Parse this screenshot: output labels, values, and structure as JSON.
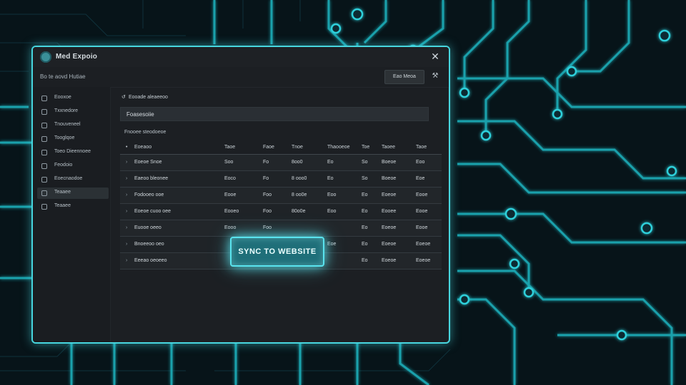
{
  "window": {
    "title": "Med Expoio"
  },
  "subbar": {
    "breadcrumb": "Bo te aovd Hutiae",
    "button_label": "Eao Meoa"
  },
  "sidebar": {
    "items": [
      {
        "label": "Eooxoe",
        "active": false
      },
      {
        "label": "Txxnedore",
        "active": false
      },
      {
        "label": "Tnouveneel",
        "active": false
      },
      {
        "label": "Tooglqoe",
        "active": false
      },
      {
        "label": "Toeo Dieennoee",
        "active": false
      },
      {
        "label": "Feodoio",
        "active": false
      },
      {
        "label": "Eoecnaodoe",
        "active": false
      },
      {
        "label": "Teaaee",
        "active": true
      },
      {
        "label": "Teaaee",
        "active": false
      }
    ]
  },
  "main": {
    "header": "Eooade aleaeeoo",
    "filter_label": "Foasesoiie",
    "section_label": "Fnooee steodoeoe",
    "table": {
      "headers": [
        "Eoeaoo",
        "Taoe",
        "Faoe",
        "Tnoe",
        "Thaooeoe",
        "Toe",
        "Taoee",
        "Taoe"
      ],
      "rows": [
        [
          "Eoeoe Snoe",
          "Soo",
          "Fo",
          "8oo0",
          "Eo",
          "So",
          "Boeoe",
          "Eoo"
        ],
        [
          "Eaeoo bleonee",
          "Eoco",
          "Fo",
          "8 ooo0",
          "Eo",
          "So",
          "Boeoe",
          "Eoe"
        ],
        [
          "Fodooeo ooe",
          "Eooe",
          "Foo",
          "8 oo0e",
          "Eoo",
          "Eo",
          "Eoeoe",
          "Eooe"
        ],
        [
          "Eoeoe cuoo oee",
          "Eooeo",
          "Foo",
          "80o0e",
          "Eoo",
          "Eo",
          "Eooee",
          "Eooe"
        ],
        [
          "Euooe oeeo",
          "Eooo",
          "Foo",
          "",
          "",
          "Eo",
          "Eoeoe",
          "Eooe"
        ],
        [
          "Bnoeeoo oeo",
          "",
          "",
          "",
          "Eoe",
          "Eo",
          "Eoeoe",
          "Eoeoe"
        ],
        [
          "Eeeao oeoeeo",
          "",
          "",
          "",
          "",
          "Eo",
          "Eoeoe",
          "Eoeoe"
        ]
      ]
    }
  },
  "sync_button": {
    "label": "SYNC TO WEBSITE"
  },
  "colors": {
    "accent": "#47d6df",
    "glow": "#59e3ee",
    "background": "#061317",
    "window": "#1c1f23"
  }
}
